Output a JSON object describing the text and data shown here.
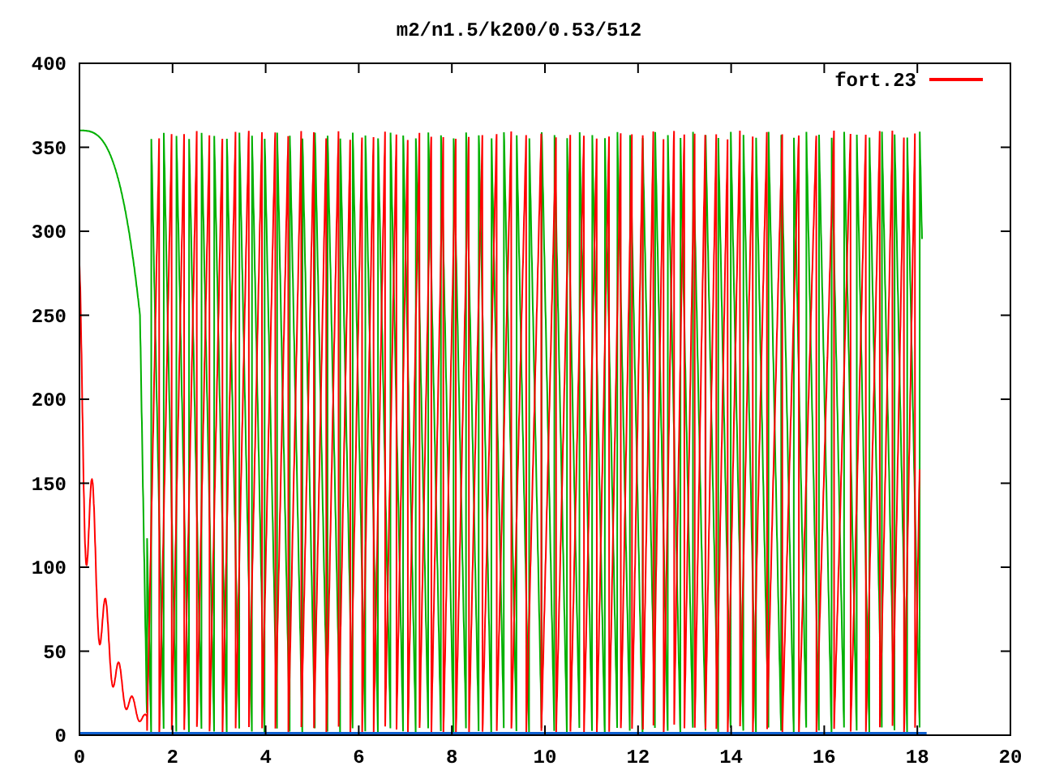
{
  "plot": {
    "title": "m2/n1.5/k200/0.53/512",
    "x_ticks": [
      "0",
      "2",
      "4",
      "6",
      "8",
      "10",
      "12",
      "14",
      "16",
      "18",
      "20"
    ],
    "y_ticks": [
      "400",
      "350",
      "300",
      "250",
      "200",
      "150",
      "100",
      "50",
      "0"
    ],
    "legend": [
      {
        "label": "fort.23",
        "color": "#ff0000"
      }
    ]
  }
}
